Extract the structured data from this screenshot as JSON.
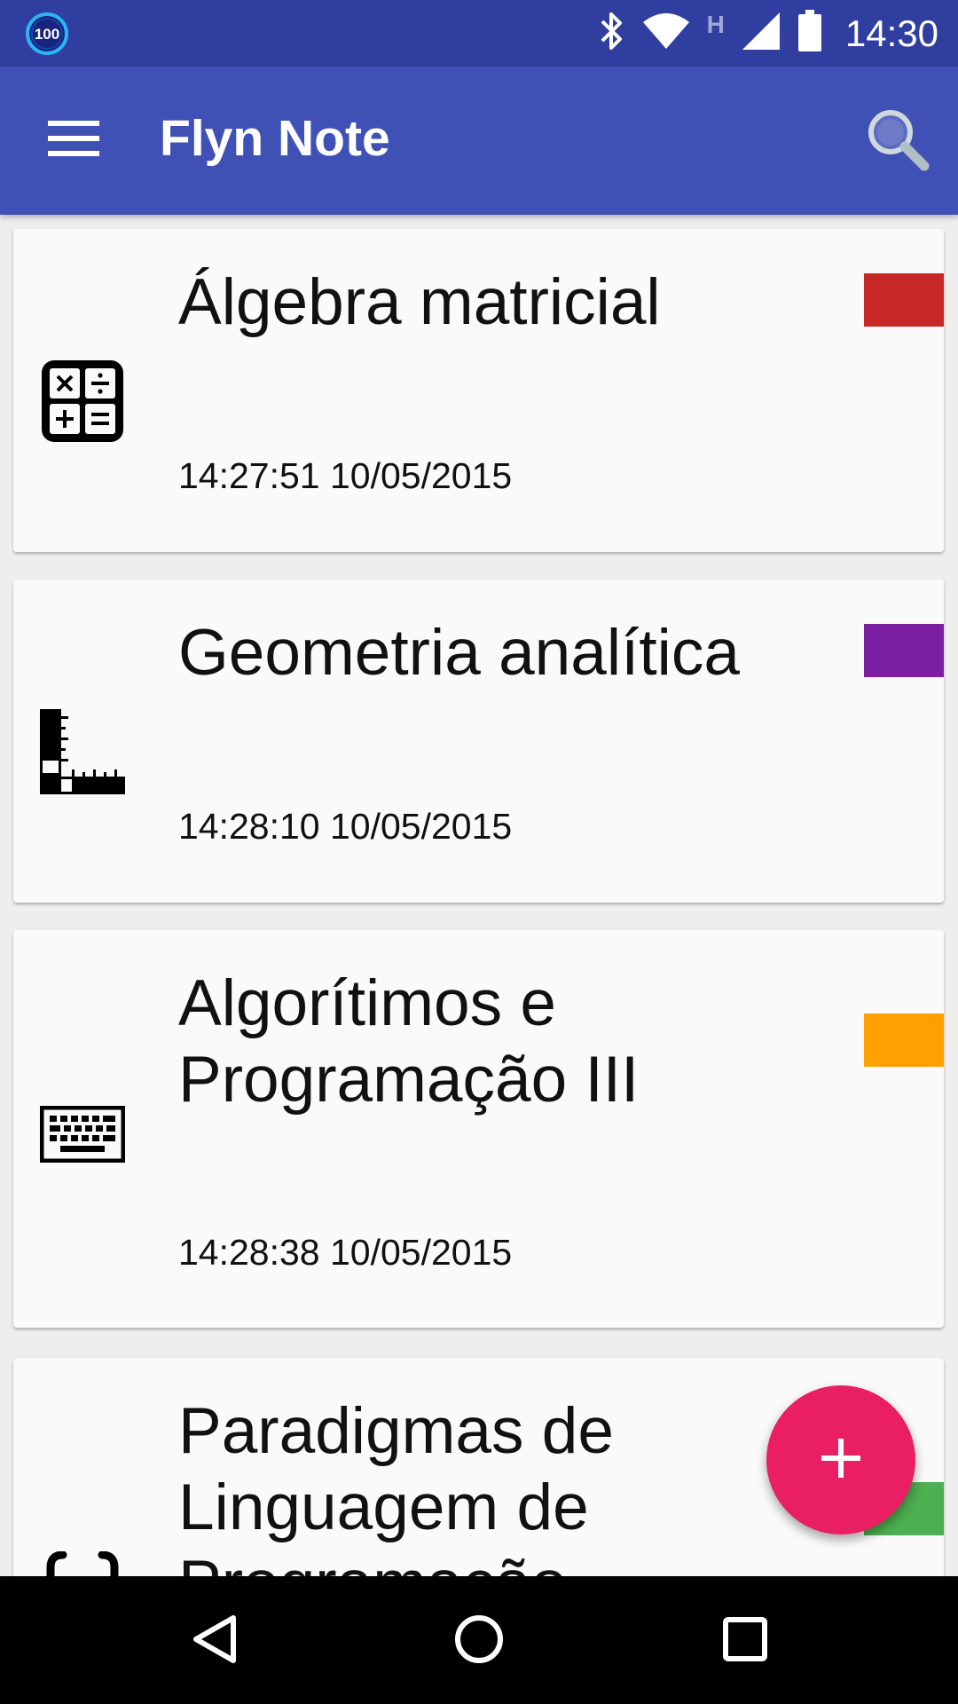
{
  "status_bar": {
    "badge_text": "100",
    "network_type": "H",
    "time": "14:30",
    "icons": [
      "bluetooth-icon",
      "wifi-icon",
      "cell-signal-icon",
      "battery-icon"
    ]
  },
  "app_bar": {
    "title": "Flyn Note",
    "menu_icon": "menu-icon",
    "search_icon": "search-icon"
  },
  "notes": [
    {
      "title": "Álgebra matricial",
      "timestamp": "14:27:51 10/05/2015",
      "icon": "calculator-icon",
      "color": "#C62828"
    },
    {
      "title": "Geometria analítica",
      "timestamp": "14:28:10 10/05/2015",
      "icon": "ruler-square-icon",
      "color": "#7B1FA2"
    },
    {
      "title": "Algorítimos e Programação III",
      "timestamp": "14:28:38 10/05/2015",
      "icon": "keyboard-icon",
      "color": "#FFA000"
    },
    {
      "title": "Paradigmas de Linguagem de Programação",
      "timestamp": "",
      "icon": "code-braces-icon",
      "color": "#4CAF50"
    }
  ],
  "fab": {
    "icon": "plus-icon",
    "color": "#E91E63"
  },
  "colors": {
    "status_bar": "#303F9F",
    "primary": "#3F51B5",
    "background": "#EEEEEE",
    "card": "#FAFAFA"
  },
  "nav_bar": {
    "icons": [
      "back-icon",
      "home-icon",
      "recents-icon"
    ]
  }
}
